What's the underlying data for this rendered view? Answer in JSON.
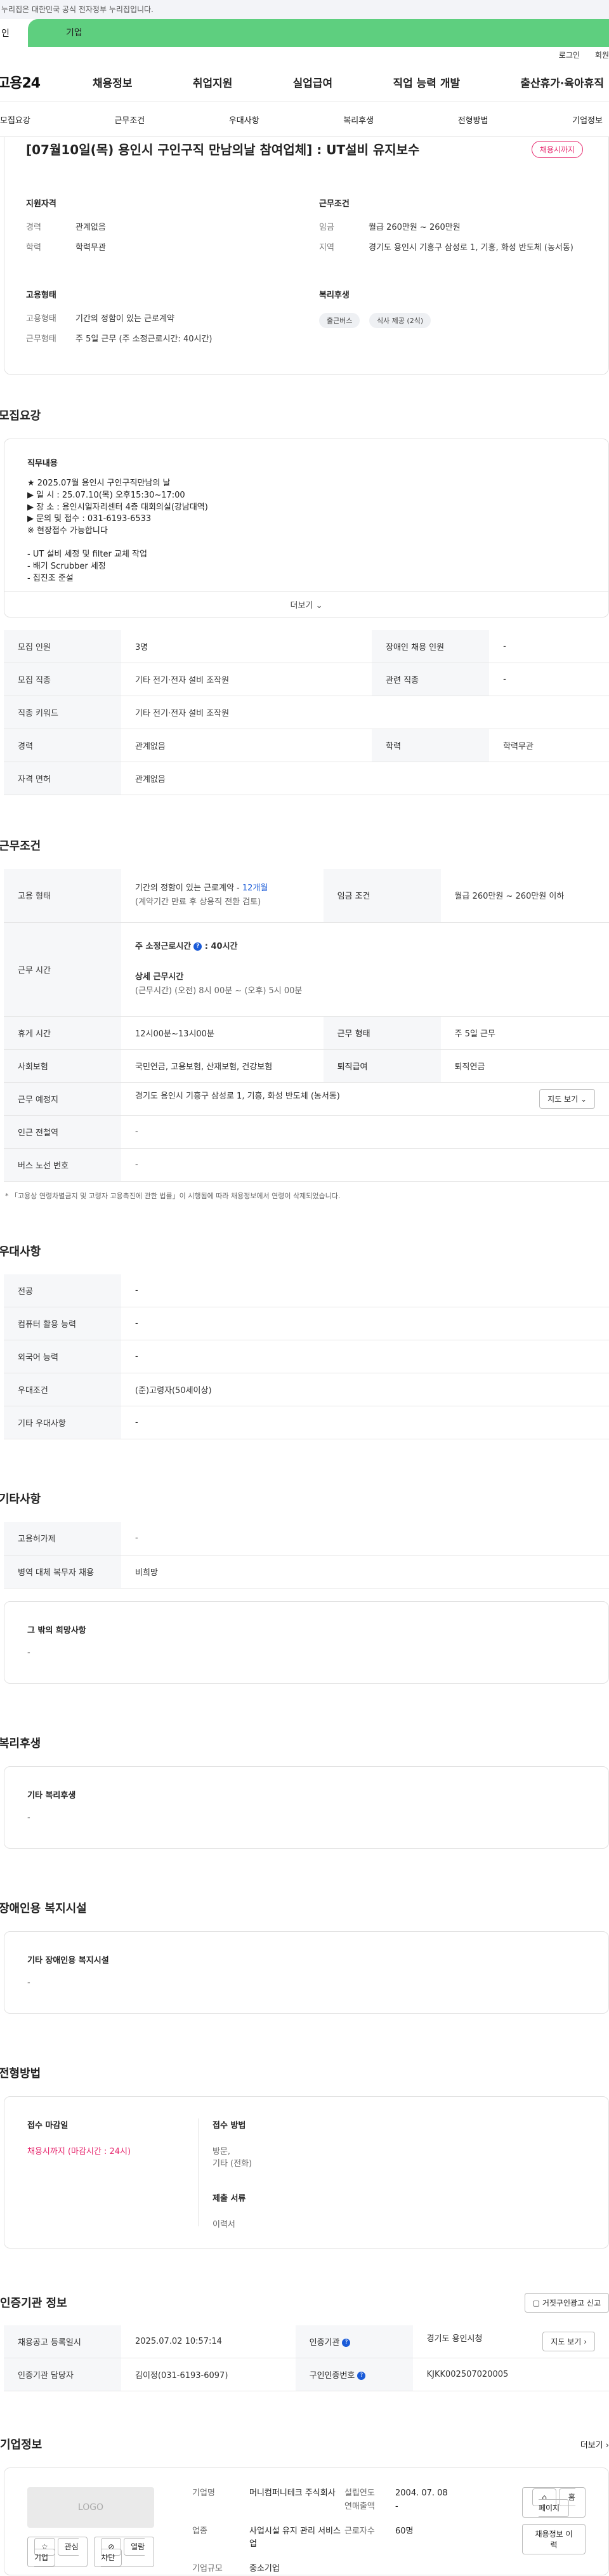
{
  "gov_banner": "누리집은 대한민국 공식 전자정부 누리집입니다.",
  "tabs": {
    "personal": "인",
    "corporate": "기업"
  },
  "util": {
    "login": "로그인",
    "join": "회원"
  },
  "logo": "고용24",
  "gnb": [
    "채용정보",
    "취업지원",
    "실업급여",
    "직업 능력 개발",
    "출산휴가·육아휴직"
  ],
  "subnav": [
    "모집요강",
    "근무조건",
    "우대사항",
    "복리후생",
    "전형방법",
    "기업정보"
  ],
  "job": {
    "title": "[07월10일(목) 용인시 구인구직 만남의날 참여업체] : UT설비 유지보수",
    "status_badge": "채용시까지"
  },
  "summary": {
    "qual_h": "지원자격",
    "career_k": "경력",
    "career_v": "관계없음",
    "edu_k": "학력",
    "edu_v": "학력무관",
    "cond_h": "근무조건",
    "wage_k": "임금",
    "wage_v": "월급 260만원 ~ 260만원",
    "region_k": "지역",
    "region_v": "경기도 용인시 기흥구 삼성로 1, 기흥, 화성 반도체 (농서동)",
    "emp_h": "고용형태",
    "emptype_k": "고용형태",
    "emptype_v": "기간의 정함이 있는 근로계약",
    "worktype_k": "근무형태",
    "worktype_v": "주 5일 근무 (주 소정근로시간: 40시간)",
    "welfare_h": "복리후생",
    "pills": [
      "출근버스",
      "식사 제공 (2식)"
    ]
  },
  "recruit": {
    "section": "모집요강",
    "desc_h": "직무내용",
    "desc_lines": [
      "★ 2025.07월 용인시 구인구직만남의 날",
      "▶ 일 시 : 25.07.10(목) 오후15:30~17:00",
      "▶ 장 소 : 용인시일자리센터 4층 대회의실(강남대역)",
      "▶ 문의 및 접수 : 031-6193-6533",
      "※ 현장접수 가능합니다",
      "",
      "- UT 설비 세정 및 filter 교체 작업",
      "- 배기 Scrubber 세정",
      "- 집진조 준설"
    ],
    "more": "더보기",
    "rows": [
      [
        "모집 인원",
        "3명",
        "장애인 채용 인원",
        "-"
      ],
      [
        "모집 직종",
        "기타 전기·전자 설비 조작원",
        "관련 직종",
        "-"
      ],
      [
        "직종 키워드",
        "기타 전기·전자 설비 조작원"
      ],
      [
        "경력",
        "관계없음",
        "학력",
        "학력무관"
      ],
      [
        "자격 면허",
        "관계없음"
      ]
    ]
  },
  "work": {
    "section": "근무조건",
    "emp_k": "고용 형태",
    "emp_v1": "기간의 정함이 있는 근로계약 - ",
    "emp_v1b": "12개월",
    "emp_v2": "(계약기간 만료 후 상용직 전환 검토)",
    "wage_k": "임금 조건",
    "wage_v": "월급 260만원 ~ 260만원 이하",
    "hours_k": "근무 시간",
    "hours_main": "주 소정근로시간",
    "hours_main_v": ": 40시간",
    "hours_detail_h": "상세 근무시간",
    "hours_detail_v": "(근무시간) (오전) 8시 00분 ~ (오후) 5시 00분",
    "rows": [
      [
        "휴게 시간",
        "12시00분~13시00분",
        "근무 형태",
        "주 5일 근무"
      ],
      [
        "사회보험",
        "국민연금, 고용보험, 산재보험, 건강보험",
        "퇴직급여",
        "퇴직연금"
      ]
    ],
    "place_k": "근무 예정지",
    "place_v": "경기도 용인시 기흥구 삼성로 1, 기흥, 화성 반도체 (농서동)",
    "map_btn": "지도 보기",
    "rows2": [
      [
        "인근 전철역",
        "-"
      ],
      [
        "버스 노선 번호",
        "-"
      ]
    ],
    "note": "* 「고용상 연령차별금지 및 고령자 고용촉진에 관한 법률」이 시행됨에 따라 채용정보에서 연령이 삭제되었습니다."
  },
  "pref": {
    "section": "우대사항",
    "rows": [
      [
        "전공",
        "-"
      ],
      [
        "컴퓨터 활용 능력",
        "-"
      ],
      [
        "외국어 능력",
        "-"
      ],
      [
        "우대조건",
        "(준)고령자(50세이상)"
      ],
      [
        "기타 우대사항",
        "-"
      ]
    ]
  },
  "etc": {
    "section": "기타사항",
    "rows": [
      [
        "고용허가제",
        "-"
      ],
      [
        "병역 대체 복무자 채용",
        "비희망"
      ]
    ],
    "box_h": "그 밖의 희망사항",
    "box_v": "-"
  },
  "welfare": {
    "section": "복리후생",
    "box_h": "기타 복리후생",
    "box_v": "-"
  },
  "disabled": {
    "section": "장애인용 복지시설",
    "box_h": "기타 장애인용 복지시설",
    "box_v": "-"
  },
  "apply": {
    "section": "전형방법",
    "deadline_h": "접수 마감일",
    "deadline_v": "채용시까지 (마감시간 : 24시)",
    "method_h": "접수 방법",
    "method_v1": "방문,",
    "method_v2": "기타 (전화)",
    "docs_h": "제출 서류",
    "docs_v": "이력서"
  },
  "inst": {
    "section": "인증기관 정보",
    "report_btn": "거짓구인광고 신고",
    "reg_k": "채용공고 등록일시",
    "reg_v": "2025.07.02 10:57:14",
    "org_k": "인증기관",
    "org_v": "경기도 용인시청",
    "map_btn": "지도 보기",
    "mgr_k": "인증기관 담당자",
    "mgr_v": "김이정(031-6193-6097)",
    "no_k": "구인인증번호",
    "no_v": "KJKK002507020005"
  },
  "corp": {
    "section": "기업정보",
    "more": "더보기",
    "logo_text": "LOGO",
    "fav_btn": "관심기업",
    "block_btn": "열람차단",
    "name_k": "기업명",
    "name_v": "머니컴퍼니테크 주식회사",
    "year_k": "설립연도",
    "year_v": "2004. 07. 08",
    "sales_k": "연매출액",
    "sales_v": "-",
    "ind_k": "업종",
    "ind_v": "사업시설 유지 관리 서비스업",
    "emp_k": "근로자수",
    "emp_v": "60명",
    "size_k": "기업규모",
    "size_v": "중소기업",
    "home_btn": "홈페이지",
    "jobs_btn": "채용정보 이력"
  }
}
